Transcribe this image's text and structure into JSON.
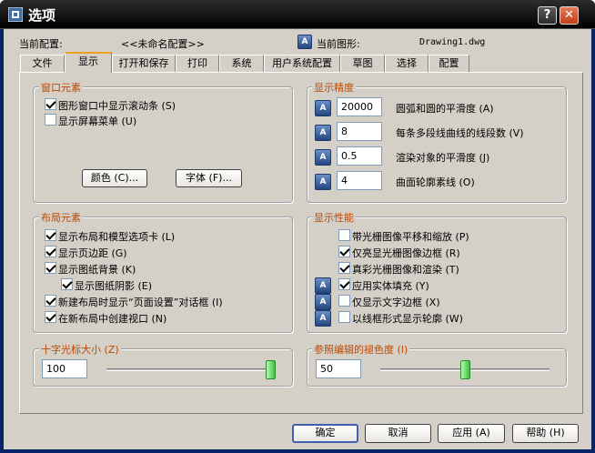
{
  "window": {
    "title": "选项",
    "help_button": "?",
    "close_button": "✕"
  },
  "profile": {
    "label": "当前配置:",
    "value": "<<未命名配置>>"
  },
  "drawing": {
    "label": "当前图形:",
    "value": "Drawing1.dwg"
  },
  "tabs": [
    "文件",
    "显示",
    "打开和保存",
    "打印",
    "系统",
    "用户系统配置",
    "草图",
    "选择",
    "配置"
  ],
  "active_tab": "显示",
  "window_elements": {
    "title": "窗口元素",
    "checkboxes": [
      {
        "label": "图形窗口中显示滚动条 (S)",
        "checked": true
      },
      {
        "label": "显示屏幕菜单 (U)",
        "checked": false
      }
    ],
    "colors_button": "颜色 (C)...",
    "fonts_button": "字体 (F)..."
  },
  "display_resolution": {
    "title": "显示精度",
    "rows": [
      {
        "value": "20000",
        "label": "圆弧和圆的平滑度 (A)"
      },
      {
        "value": "8",
        "label": "每条多段线曲线的线段数 (V)"
      },
      {
        "value": "0.5",
        "label": "渲染对象的平滑度 (J)"
      },
      {
        "value": "4",
        "label": "曲面轮廓素线 (O)"
      }
    ]
  },
  "layout_elements": {
    "title": "布局元素",
    "checkboxes": [
      {
        "label": "显示布局和模型选项卡 (L)",
        "checked": true
      },
      {
        "label": "显示页边距 (G)",
        "checked": true
      },
      {
        "label": "显示图纸背景 (K)",
        "checked": true
      },
      {
        "label": "显示图纸阴影 (E)",
        "checked": true
      },
      {
        "label": "新建布局时显示“页面设置”对话框 (I)",
        "checked": true
      },
      {
        "label": "在新布局中创建视口 (N)",
        "checked": true
      }
    ]
  },
  "display_performance": {
    "title": "显示性能",
    "checkboxes": [
      {
        "label": "带光栅图像平移和缩放 (P)",
        "checked": false,
        "icon": false
      },
      {
        "label": "仅亮显光栅图像边框 (R)",
        "checked": true,
        "icon": false
      },
      {
        "label": "真彩光栅图像和渲染 (T)",
        "checked": true,
        "icon": false
      },
      {
        "label": "应用实体填充 (Y)",
        "checked": true,
        "icon": true
      },
      {
        "label": "仅显示文字边框 (X)",
        "checked": false,
        "icon": true
      },
      {
        "label": "以线框形式显示轮廓 (W)",
        "checked": false,
        "icon": true
      }
    ]
  },
  "crosshair": {
    "title": "十字光标大小 (Z)",
    "value": "100",
    "level": 1.0
  },
  "xref_fade": {
    "title": "参照编辑的褪色度 (I)",
    "value": "50",
    "level": 0.5
  },
  "buttons": {
    "ok": "确定",
    "cancel": "取消",
    "apply": "应用 (A)",
    "help": "帮助 (H)"
  },
  "colors": {
    "title_bar": "#000000",
    "dialog_bg": "#d4d0c8",
    "group_title": "#c04800",
    "tab_highlight": "#f0a020"
  }
}
